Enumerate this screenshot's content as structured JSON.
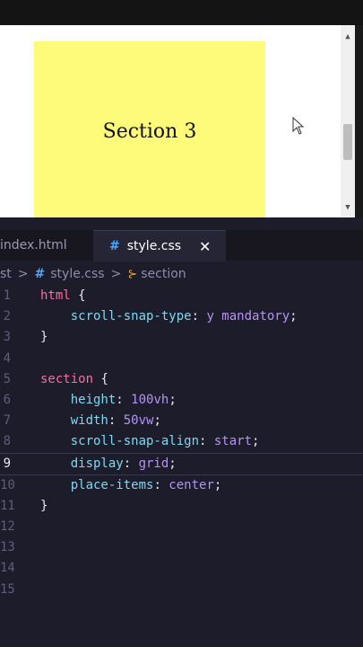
{
  "preview": {
    "section_label": "Section 3",
    "scroll_up": "▲",
    "scroll_down": "▼"
  },
  "editor": {
    "tabs": [
      {
        "label": "index.html"
      },
      {
        "label": "style.css",
        "icon": "hash-icon",
        "close": "✕"
      }
    ],
    "breadcrumb": {
      "root": "st",
      "sep1": ">",
      "file_icon": "#",
      "file": "style.css",
      "sep2": ">",
      "symbol_icon": "⊱",
      "symbol": "section"
    },
    "active_line": 9,
    "lines": [
      {
        "n": "1",
        "tokens": [
          {
            "t": "html",
            "c": "k-sel"
          },
          {
            "t": " {",
            "c": "k-punc"
          }
        ]
      },
      {
        "n": "2",
        "tokens": [
          {
            "t": "    scroll-snap-type",
            "c": "k-prop"
          },
          {
            "t": ": ",
            "c": "k-punc"
          },
          {
            "t": "y mandatory",
            "c": "k-val"
          },
          {
            "t": ";",
            "c": "k-punc"
          }
        ]
      },
      {
        "n": "3",
        "tokens": [
          {
            "t": "}",
            "c": "k-punc"
          }
        ]
      },
      {
        "n": "4",
        "tokens": []
      },
      {
        "n": "5",
        "tokens": [
          {
            "t": "section",
            "c": "k-sel"
          },
          {
            "t": " {",
            "c": "k-punc"
          }
        ]
      },
      {
        "n": "6",
        "tokens": [
          {
            "t": "    height",
            "c": "k-prop"
          },
          {
            "t": ": ",
            "c": "k-punc"
          },
          {
            "t": "100vh",
            "c": "k-val"
          },
          {
            "t": ";",
            "c": "k-punc"
          }
        ]
      },
      {
        "n": "7",
        "tokens": [
          {
            "t": "    width",
            "c": "k-prop"
          },
          {
            "t": ": ",
            "c": "k-punc"
          },
          {
            "t": "50vw",
            "c": "k-val"
          },
          {
            "t": ";",
            "c": "k-punc"
          }
        ]
      },
      {
        "n": "8",
        "tokens": [
          {
            "t": "    scroll-snap-align",
            "c": "k-prop"
          },
          {
            "t": ": ",
            "c": "k-punc"
          },
          {
            "t": "start",
            "c": "k-val"
          },
          {
            "t": ";",
            "c": "k-punc"
          }
        ]
      },
      {
        "n": "9",
        "tokens": [
          {
            "t": "    display",
            "c": "k-prop"
          },
          {
            "t": ": ",
            "c": "k-punc"
          },
          {
            "t": "grid",
            "c": "k-val"
          },
          {
            "t": ";",
            "c": "k-punc"
          }
        ]
      },
      {
        "n": "10",
        "tokens": [
          {
            "t": "    place-items",
            "c": "k-prop"
          },
          {
            "t": ": ",
            "c": "k-punc"
          },
          {
            "t": "center",
            "c": "k-val"
          },
          {
            "t": ";",
            "c": "k-punc"
          }
        ]
      },
      {
        "n": "11",
        "tokens": [
          {
            "t": "}",
            "c": "k-punc"
          }
        ]
      },
      {
        "n": "12",
        "tokens": []
      },
      {
        "n": "13",
        "tokens": []
      },
      {
        "n": "14",
        "tokens": []
      },
      {
        "n": "15",
        "tokens": []
      }
    ]
  },
  "colors": {
    "section_bg": "#fffb7a",
    "editor_bg": "#1d1c2a",
    "selector": "#ff6b9a",
    "property": "#7fd8f0",
    "value": "#b593f5"
  }
}
